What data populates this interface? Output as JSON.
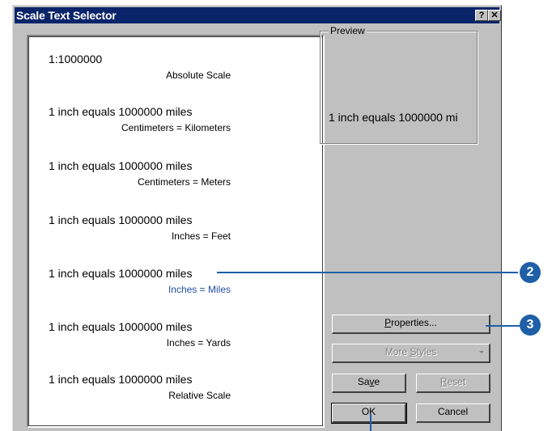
{
  "window": {
    "title": "Scale Text Selector",
    "help_button": "?",
    "close_button": "✕"
  },
  "scale_list": [
    {
      "title": "1:1000000",
      "subtitle": "Absolute Scale"
    },
    {
      "title": "1 inch equals 1000000 miles",
      "subtitle": "Centimeters = Kilometers"
    },
    {
      "title": "1 inch equals 1000000 miles",
      "subtitle": "Centimeters = Meters"
    },
    {
      "title": "1 inch equals 1000000 miles",
      "subtitle": "Inches = Feet"
    },
    {
      "title": "1 inch equals 1000000 miles",
      "subtitle": "Inches = Miles"
    },
    {
      "title": "1 inch equals 1000000 miles",
      "subtitle": "Inches = Yards"
    },
    {
      "title": "1 inch equals 1000000 miles",
      "subtitle": "Relative Scale"
    }
  ],
  "preview": {
    "label": "Preview",
    "text": "1 inch equals 1000000 mi"
  },
  "buttons": {
    "properties": {
      "pre": "",
      "ul": "P",
      "post": "roperties..."
    },
    "more_styles": {
      "pre": "More ",
      "ul": "S",
      "post": "tyles"
    },
    "save": {
      "pre": "Sa",
      "ul": "v",
      "post": "e"
    },
    "reset": {
      "pre": "",
      "ul": "R",
      "post": "eset"
    },
    "ok": "OK",
    "cancel": "Cancel"
  },
  "callouts": {
    "step_2": "2",
    "step_3": "3",
    "color": "#1f5fa8"
  }
}
